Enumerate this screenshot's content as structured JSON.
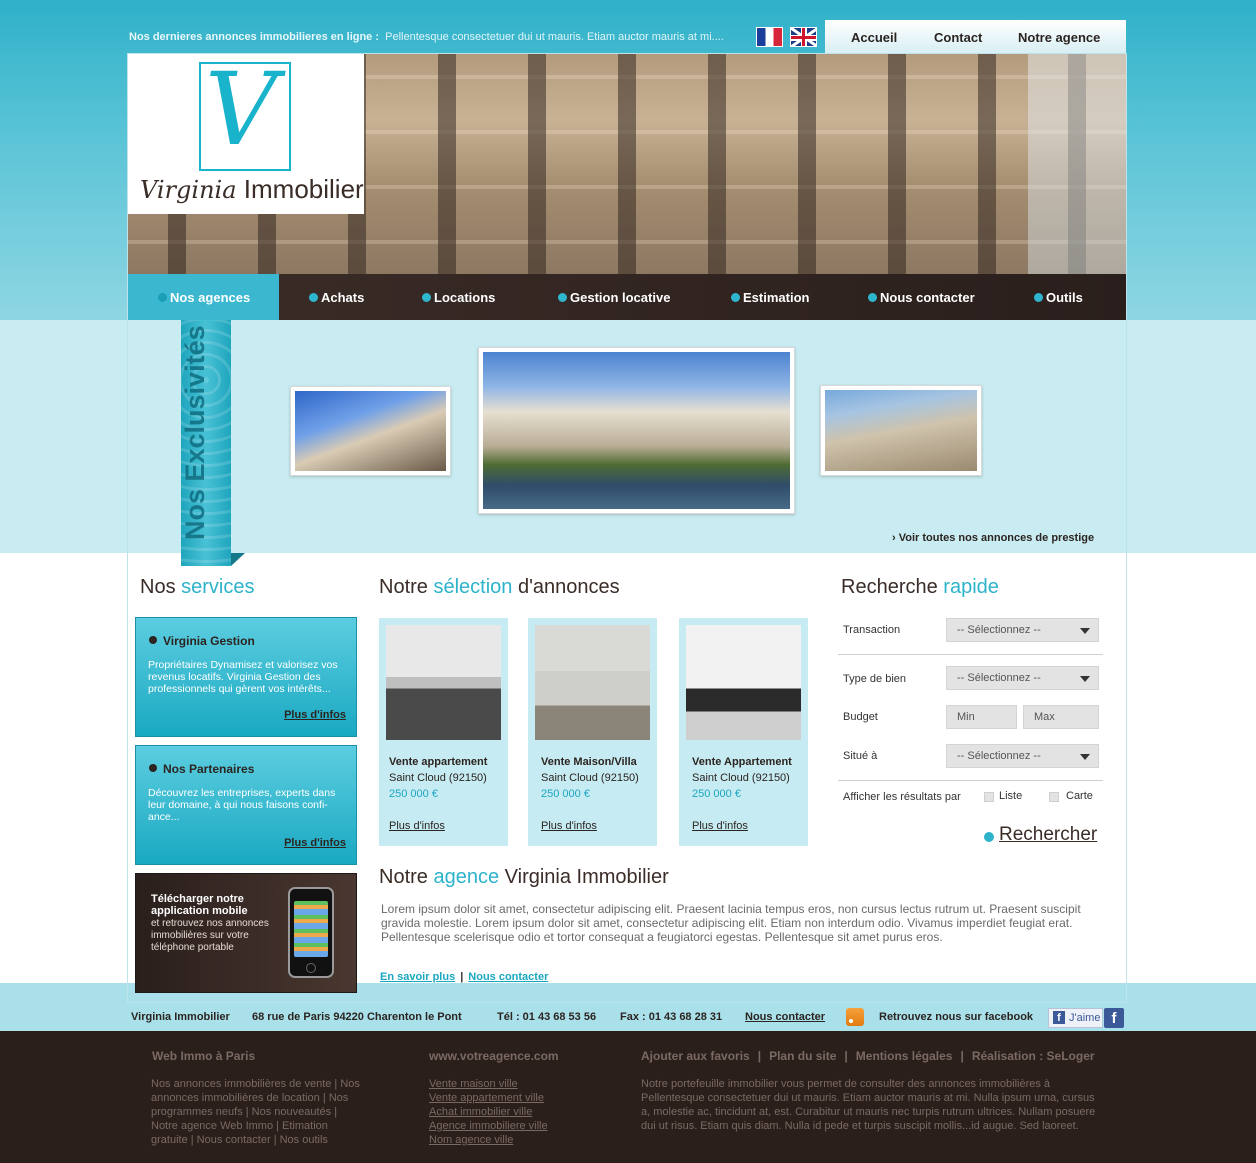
{
  "topbar": {
    "headline_label": "Nos dernieres annonces immobilieres en ligne :",
    "headline_text": "Pellentesque consectetuer dui ut mauris. Etiam auctor mauris at mi....",
    "nav": [
      "Accueil",
      "Contact",
      "Notre agence"
    ]
  },
  "logo": {
    "script_word": "Virginia",
    "word": "Immobilier",
    "monogram": "V"
  },
  "mainnav": {
    "items": [
      "Nos agences",
      "Achats",
      "Locations",
      "Gestion locative",
      "Estimation",
      "Nous contacter",
      "Outils"
    ],
    "active_index": 0
  },
  "exclusivites": {
    "label": "Nos Exclusivités",
    "link": "› Voir toutes nos annonces de prestige"
  },
  "services": {
    "heading_a": "Nos ",
    "heading_b": "services",
    "blocks": [
      {
        "title": "Virginia Gestion",
        "text": "Propriétaires Dynamisez et valorisez vos revenus locatifs. Virginia Gestion des professionnels qui gèrent vos intérêts...",
        "more": "Plus d'infos"
      },
      {
        "title": "Nos Partenaires",
        "text": "Découvrez les entreprises, experts dans leur domaine, à qui nous faisons confi-ance...",
        "more": "Plus d'infos"
      }
    ],
    "app": {
      "title": "Télécharger notre application mobile",
      "text": "et retrouvez nos annonces immobilières sur votre téléphone portable"
    }
  },
  "selection": {
    "heading_a": "Notre ",
    "heading_b": "sélection",
    "heading_c": " d'annonces",
    "cards": [
      {
        "title": "Vente appartement",
        "location": "Saint Cloud  (92150)",
        "price": "250 000 €",
        "more": "Plus d'infos"
      },
      {
        "title": "Vente Maison/Villa",
        "location": "Saint Cloud  (92150)",
        "price": "250 000 €",
        "more": "Plus d'infos"
      },
      {
        "title": "Vente Appartement",
        "location": "Saint Cloud  (92150)",
        "price": "250 000 €",
        "more": "Plus d'infos"
      }
    ]
  },
  "agence": {
    "heading_a": "Notre ",
    "heading_b": "agence",
    "heading_c": " Virginia Immobilier",
    "text": "Lorem ipsum dolor sit amet, consectetur adipiscing elit. Praesent lacinia tempus eros, non cursus lectus rutrum ut. Praesent suscipit gravida molestie. Lorem ipsum dolor sit amet, consectetur adipiscing elit. Etiam non interdum odio. Vivamus imperdiet feugiat erat. Pellentesque scelerisque odio et tortor consequat a feugiatorci egestas. Pellentesque sit amet purus eros.",
    "link_more": "En savoir plus",
    "link_contact": "Nous contacter",
    "separator": "|"
  },
  "search": {
    "heading_a": "Recherche ",
    "heading_b": "rapide",
    "transaction_label": "Transaction",
    "transaction_value": "-- Sélectionnez --",
    "type_label": "Type de bien",
    "type_value": "-- Sélectionnez --",
    "budget_label": "Budget",
    "min_placeholder": "Min",
    "max_placeholder": "Max",
    "situe_label": "Situé à",
    "situe_value": "-- Sélectionnez --",
    "display_label": "Afficher les résultats par",
    "opt_liste": "Liste",
    "opt_carte": "Carte",
    "button": "Rechercher"
  },
  "infobar": {
    "name": "Virginia Immobilier",
    "address": "68 rue de Paris 94220 Charenton le Pont",
    "tel": "Tél : 01 43 68 53 56",
    "fax": "Fax : 01 43 68 28 31",
    "contact": "Nous contacter",
    "facebook": "Retrouvez nous sur facebook",
    "like": "J'aime"
  },
  "footer": {
    "col1_title": "Web Immo à Paris",
    "col1_text": "Nos annonces immobilières de vente | Nos annonces immobilières de location | Nos programmes neufs | Nos nouveautés | Notre agence Web Immo | Etimation gratuite | Nous contacter | Nos outils",
    "col2_title": "www.votreagence.com",
    "col2_links": [
      "Vente maison ville",
      "Vente appartement ville",
      "Achat immobilier ville",
      "Agence immobiliere ville",
      "Nom agence ville"
    ],
    "col3_links": [
      "Ajouter aux favoris",
      "Plan du site",
      "Mentions légales",
      "Réalisation : SeLoger"
    ],
    "col3_text": "Notre portefeuille immobilier vous permet de consulter des annonces immobilières à Pellentesque consectetuer dui ut mauris. Etiam auctor mauris at mi. Nulla ipsum urna, cursus a, molestie ac, tincidunt at, est. Curabitur ut mauris nec turpis rutrum ultrices. Nullam posuere dui ut risus. Etiam quis diam. Nulla id pede et turpis suscipit mollis...id augue. Sed laoreet."
  },
  "colors": {
    "accent": "#2db3ca",
    "dark": "#2b1f1c",
    "light_band": "#c9ecf3"
  }
}
